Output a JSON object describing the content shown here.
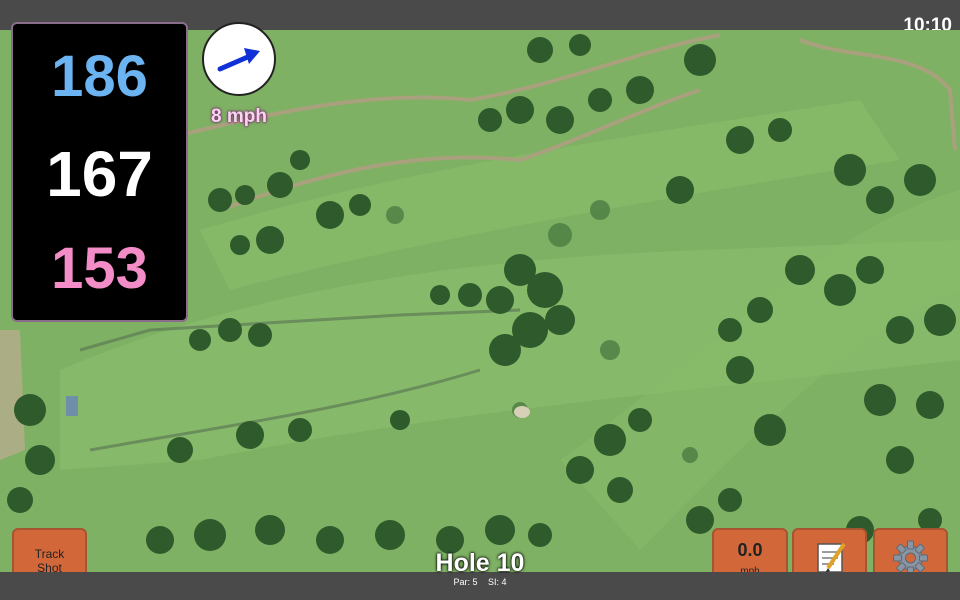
{
  "status": {
    "time": "10:10"
  },
  "distances": {
    "back": "186",
    "middle": "167",
    "front": "153"
  },
  "wind": {
    "speed": "8 mph",
    "icon": "wind-direction-arrow-icon"
  },
  "buttons": {
    "track_shot": "Track\nShot",
    "speed_value": "0.0",
    "speed_unit": "mph",
    "notes_icon": "notepad-icon",
    "settings_icon": "gear-icon"
  },
  "hole": {
    "title": "Hole 10",
    "par": "Par: 5",
    "si": "SI: 4"
  },
  "colors": {
    "back_distance": "#6cb3f2",
    "middle_distance": "#ffffff",
    "front_distance": "#f48cc8",
    "button": "#d2683a",
    "wind_text": "#f8d7ee"
  }
}
